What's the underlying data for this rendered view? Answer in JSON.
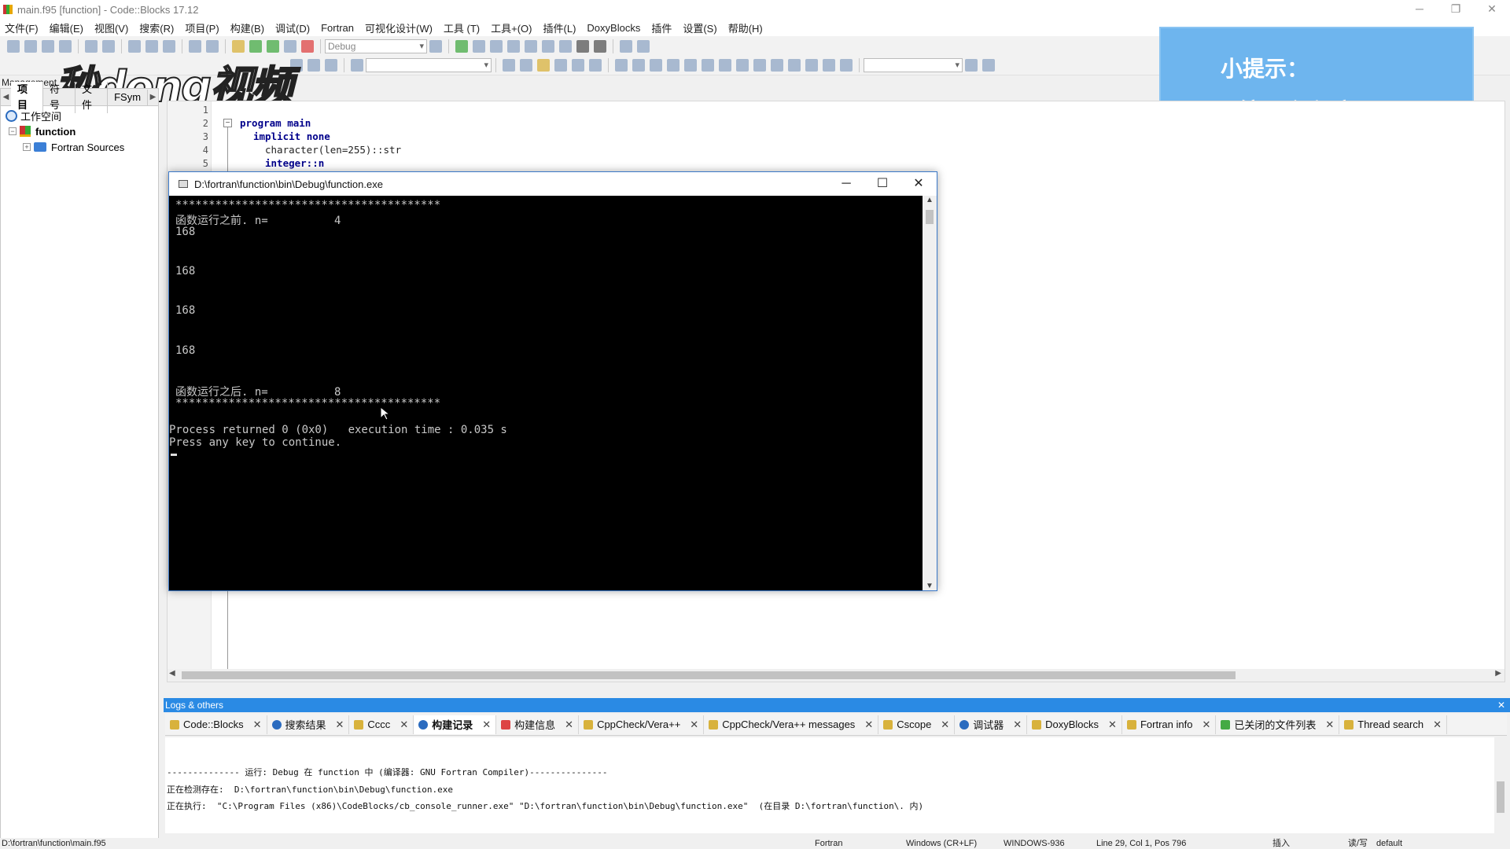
{
  "window": {
    "title": "main.f95 [function] - Code::Blocks 17.12",
    "min": "─",
    "max": "❐",
    "close": "✕"
  },
  "menu": [
    "文件(F)",
    "编辑(E)",
    "视图(V)",
    "搜索(R)",
    "项目(P)",
    "构建(B)",
    "调试(D)",
    "Fortran",
    "可视化设计(W)",
    "工具 (T)",
    "工具+(O)",
    "插件(L)",
    "DoxyBlocks",
    "插件",
    "设置(S)",
    "帮助(H)"
  ],
  "toolbar": {
    "build_target": "Debug"
  },
  "watermark": "秒dong视频",
  "hint": {
    "title": "小提示：",
    "text": "编写主程序"
  },
  "management": {
    "label": "Management",
    "tabs": [
      "项目",
      "符号",
      "文件",
      "FSym"
    ],
    "tree": {
      "workspace": "工作空间",
      "project": "function",
      "folder": "Fortran Sources"
    }
  },
  "editor": {
    "lines": [
      {
        "n": "1",
        "code": ""
      },
      {
        "n": "2",
        "code": "program main"
      },
      {
        "n": "3",
        "code": "implicit none"
      },
      {
        "n": "4",
        "code": "character(len=255)::str"
      },
      {
        "n": "5",
        "code": "integer::n"
      }
    ]
  },
  "console": {
    "title": "D:\\fortran\\function\\bin\\Debug\\function.exe",
    "lines": [
      "****************************************",
      "函数运行之前. n=          4",
      "168",
      "",
      "",
      "168",
      "",
      "",
      "168",
      "",
      "",
      "168",
      "",
      "",
      "函数运行之后. n=          8",
      "****************************************",
      "",
      "Process returned 0 (0x0)   execution time : 0.035 s",
      "Press any key to continue."
    ]
  },
  "logs": {
    "title": "Logs & others",
    "tabs": [
      "Code::Blocks",
      "搜索结果",
      "Cccc",
      "构建记录",
      "构建信息",
      "CppCheck/Vera++",
      "CppCheck/Vera++ messages",
      "Cscope",
      "调试器",
      "DoxyBlocks",
      "Fortran info",
      "已关闭的文件列表",
      "Thread search"
    ],
    "active_tab": "构建记录",
    "lines": [
      "-------------- 运行: Debug 在 function 中 (编译器: GNU Fortran Compiler)---------------",
      "正在检测存在:  D:\\fortran\\function\\bin\\Debug\\function.exe",
      "正在执行:  \"C:\\Program Files (x86)\\CodeBlocks/cb_console_runner.exe\" \"D:\\fortran\\function\\bin\\Debug\\function.exe\"  (在目录 D:\\fortran\\function\\. 内)"
    ]
  },
  "status": {
    "file": "D:\\fortran\\function\\main.f95",
    "lang": "Fortran",
    "eol": "Windows (CR+LF)",
    "encoding": "WINDOWS-936",
    "position": "Line 29, Col 1, Pos 796",
    "mode": "插入",
    "rw": "读/写",
    "profile": "default"
  }
}
